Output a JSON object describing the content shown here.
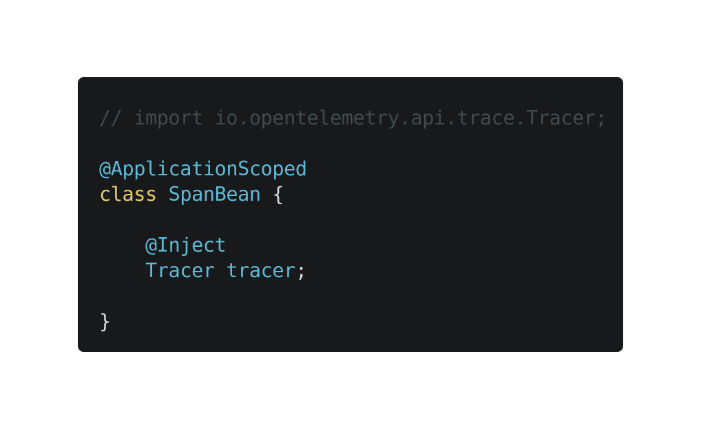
{
  "code": {
    "comment": "// import io.opentelemetry.api.trace.Tracer;",
    "annotation_scope": "@ApplicationScoped",
    "keyword_class": "class",
    "class_name": "SpanBean",
    "open_brace": "{",
    "annotation_inject": "@Inject",
    "field_type": "Tracer",
    "field_name": "tracer",
    "semicolon": ";",
    "close_brace": "}",
    "indent": "    ",
    "space": " "
  },
  "colors": {
    "background": "#18191b",
    "comment": "#3f4a4f",
    "annotation": "#5dbbd9",
    "keyword": "#e8cf6b",
    "text": "#d7d7d7"
  }
}
